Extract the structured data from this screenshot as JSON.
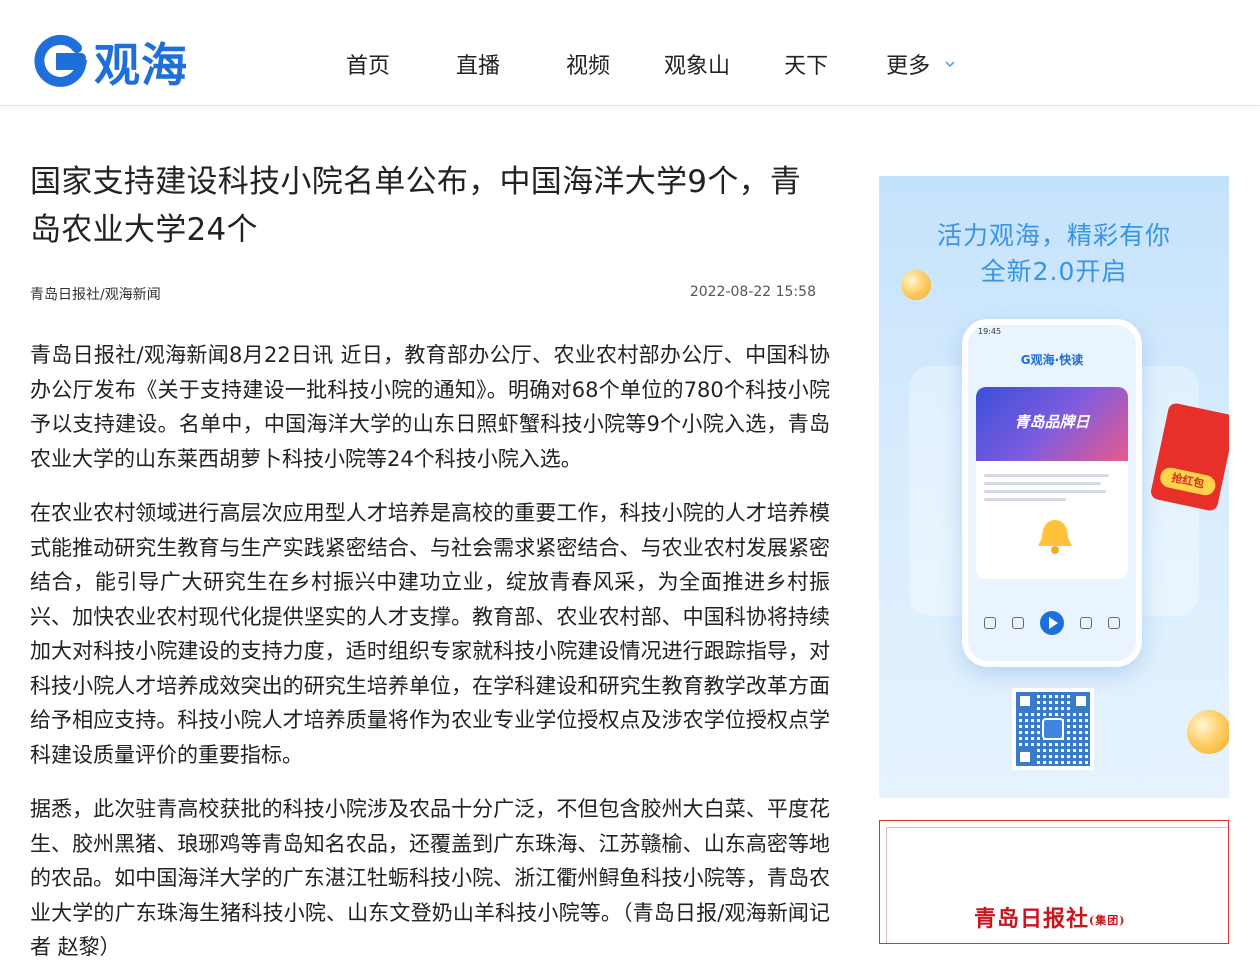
{
  "header": {
    "logo_text": "观海",
    "nav": [
      "首页",
      "直播",
      "视频",
      "观象山",
      "天下",
      "更多"
    ]
  },
  "article": {
    "title": "国家支持建设科技小院名单公布，中国海洋大学9个，青岛农业大学24个",
    "source": "青岛日报社/观海新闻",
    "time": "2022-08-22 15:58",
    "paragraphs": [
      "青岛日报社/观海新闻8月22日讯 近日，教育部办公厅、农业农村部办公厅、中国科协办公厅发布《关于支持建设一批科技小院的通知》。明确对68个单位的780个科技小院予以支持建设。名单中，中国海洋大学的山东日照虾蟹科技小院等9个小院入选，青岛农业大学的山东莱西胡萝卜科技小院等24个科技小院入选。",
      "在农业农村领域进行高层次应用型人才培养是高校的重要工作，科技小院的人才培养模式能推动研究生教育与生产实践紧密结合、与社会需求紧密结合、与农业农村发展紧密结合，能引导广大研究生在乡村振兴中建功立业，绽放青春风采，为全面推进乡村振兴、加快农业农村现代化提供坚实的人才支撑。教育部、农业农村部、中国科协将持续加大对科技小院建设的支持力度，适时组织专家就科技小院建设情况进行跟踪指导，对科技小院人才培养成效突出的研究生培养单位，在学科建设和研究生教育教学改革方面给予相应支持。科技小院人才培养质量将作为农业专业学位授权点及涉农学位授权点学科建设质量评价的重要指标。",
      "据悉，此次驻青高校获批的科技小院涉及农品十分广泛，不但包含胶州大白菜、平度花生、胶州黑猪、琅琊鸡等青岛知名农品，还覆盖到广东珠海、江苏赣榆、山东高密等地的农品。如中国海洋大学的广东湛江牡蛎科技小院、浙江衢州鲟鱼科技小院等，青岛农业大学的广东珠海生猪科技小院、山东文登奶山羊科技小院等。（青岛日报/观海新闻记者 赵黎）"
    ]
  },
  "sidebar": {
    "ad": {
      "line1": "活力观海，精彩有你",
      "line2": "全新2.0开启",
      "phone_time": "19:45",
      "phone_app": "G观海·快读",
      "phone_banner": "青岛品牌日",
      "redpack_label": "抢红包"
    },
    "promo2": {
      "text": "青岛日报社",
      "sub": "(集团)"
    }
  },
  "colors": {
    "brand": "#1e6fd9",
    "ad_text": "#3a94e4",
    "promo_red": "#c8161d"
  }
}
